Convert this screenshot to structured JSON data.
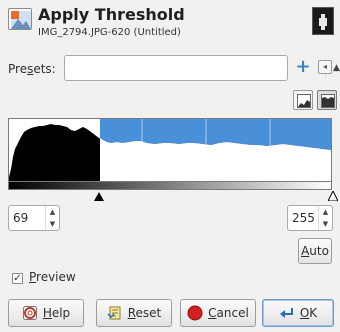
{
  "dialog": {
    "title": "Apply Threshold",
    "subtitle": "IMG_2794.JPG-620 (Untitled)"
  },
  "presets": {
    "label_pre": "Pre",
    "label_mnemonic": "s",
    "label_post": "ets:",
    "value": ""
  },
  "threshold": {
    "low": "69",
    "high": "255"
  },
  "buttons": {
    "auto_mnemonic": "A",
    "auto_rest": "uto",
    "help_mnemonic": "H",
    "help_rest": "elp",
    "reset_mnemonic": "R",
    "reset_rest": "eset",
    "cancel_mnemonic": "C",
    "cancel_rest": "ancel",
    "ok_mnemonic": "O",
    "ok_rest": "K"
  },
  "preview": {
    "checked": true,
    "mark": "✓",
    "label_mnemonic": "P",
    "label_rest": "review"
  },
  "colors": {
    "selection": "#4a90d9",
    "histogram": "#000000",
    "cancel_icon": "#d42020"
  },
  "icons": {
    "dialog": "threshold-dialog-icon",
    "thumbnail": "image-thumbnail",
    "presets_add": "plus-icon",
    "presets_menu": "menu-arrow-icon",
    "linear": "linear-histogram-icon",
    "log": "logarithmic-histogram-icon",
    "help": "help-icon",
    "reset": "reset-icon",
    "cancel": "cancel-icon",
    "ok": "ok-icon"
  }
}
